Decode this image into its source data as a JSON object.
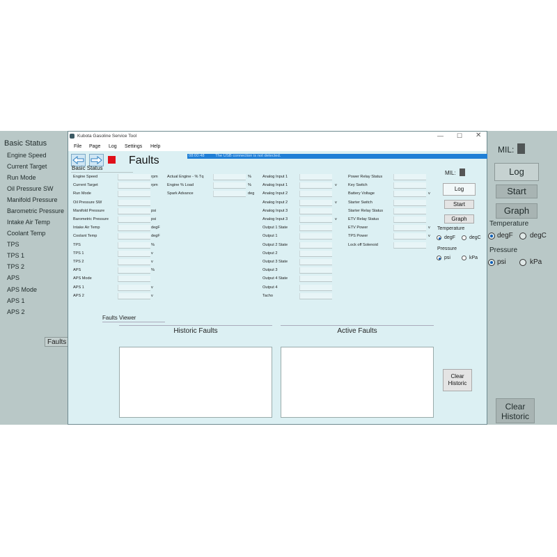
{
  "background_window": {
    "left_list": [
      "Basic Status",
      "Engine Speed",
      "Current Target",
      "Run Mode",
      "Oil Pressure SW",
      "Manifold Pressure",
      "Barometric Pressure",
      "Intake Air Temp",
      "Coolant Temp",
      "TPS",
      "TPS 1",
      "TPS 2",
      "APS",
      "APS Mode",
      "APS 1",
      "APS 2"
    ],
    "faults_label": "Faults",
    "mil_label": "MIL:",
    "log_label": "Log",
    "start_label": "Start",
    "graph_label": "Graph",
    "temperature_label": "Temperature",
    "degF": "degF",
    "degC": "degC",
    "pressure_label": "Pressure",
    "psi": "psi",
    "kPa": "kPa",
    "clear_historic": "Clear Historic"
  },
  "window": {
    "title": "Kubota Gasoline Service Tool",
    "menu": [
      "File",
      "Page",
      "Log",
      "Settings",
      "Help"
    ],
    "status_time": "08:00:48",
    "status_message": "The USB connection is not detected.",
    "page_title": "Faults",
    "section_title": "Basic Status",
    "col1": [
      {
        "label": "Engine Speed",
        "unit": "rpm"
      },
      {
        "label": "Current Target",
        "unit": "rpm"
      },
      {
        "label": "Run Mode",
        "unit": ""
      },
      {
        "label": "Oil Pressure SW",
        "unit": ""
      },
      {
        "label": "Manifold Pressure",
        "unit": "psi"
      },
      {
        "label": "Barometric Pressure",
        "unit": "psi"
      },
      {
        "label": "Intake Air Temp",
        "unit": "degF"
      },
      {
        "label": "Coolant Temp",
        "unit": "degF"
      },
      {
        "label": "TPS",
        "unit": "%"
      },
      {
        "label": "TPS 1",
        "unit": "v"
      },
      {
        "label": "TPS 2",
        "unit": "v"
      },
      {
        "label": "APS",
        "unit": "%"
      },
      {
        "label": "APS Mode",
        "unit": ""
      },
      {
        "label": "APS 1",
        "unit": "v"
      },
      {
        "label": "APS 2",
        "unit": "v"
      }
    ],
    "col2": [
      {
        "label": "Actual Engine - % Tq",
        "unit": "%"
      },
      {
        "label": "Engine % Load",
        "unit": "%"
      },
      {
        "label": "Spark Advance",
        "unit": "deg"
      }
    ],
    "col3": [
      {
        "label": "Analog Input 1",
        "unit": ""
      },
      {
        "label": "Analog Input 1",
        "unit": "v"
      },
      {
        "label": "Analog Input 2",
        "unit": ""
      },
      {
        "label": "Analog Input 2",
        "unit": "v"
      },
      {
        "label": "Analog Input 3",
        "unit": ""
      },
      {
        "label": "Analog Input 3",
        "unit": "v"
      },
      {
        "label": "Output 1 State",
        "unit": ""
      },
      {
        "label": "Output 1",
        "unit": ""
      },
      {
        "label": "Output 2 State",
        "unit": ""
      },
      {
        "label": "Output 2",
        "unit": ""
      },
      {
        "label": "Output 3 State",
        "unit": ""
      },
      {
        "label": "Output 3",
        "unit": ""
      },
      {
        "label": "Output 4 State",
        "unit": ""
      },
      {
        "label": "Output 4",
        "unit": ""
      },
      {
        "label": "Tacho",
        "unit": ""
      }
    ],
    "col4": [
      {
        "label": "Power Relay Status",
        "unit": ""
      },
      {
        "label": "Key Switch",
        "unit": ""
      },
      {
        "label": "Battery Voltage",
        "unit": "v"
      },
      {
        "label": "Starter Switch",
        "unit": ""
      },
      {
        "label": "Starter Relay Status",
        "unit": ""
      },
      {
        "label": "ETV Relay Status",
        "unit": ""
      },
      {
        "label": "ETV Power",
        "unit": "v"
      },
      {
        "label": "TPS Power",
        "unit": "v"
      },
      {
        "label": "Lock off Solenoid",
        "unit": ""
      }
    ],
    "mil_label": "MIL:",
    "log_label": "Log",
    "start_label": "Start",
    "graph_label": "Graph",
    "temperature_label": "Temperature",
    "degF": "degF",
    "degC": "degC",
    "pressure_label": "Pressure",
    "psi": "psi",
    "kPa": "kPa",
    "faults_viewer_label": "Faults Viewer",
    "historic_faults": "Historic Faults",
    "active_faults": "Active Faults",
    "clear_historic": "Clear Historic",
    "selected_temperature_unit": "degF",
    "selected_pressure_unit": "psi"
  },
  "colors": {
    "accent": "#0b5fb8",
    "status_bar": "#1f7fd6",
    "stop": "#e0101a",
    "content_bg": "#dcf0f3"
  }
}
